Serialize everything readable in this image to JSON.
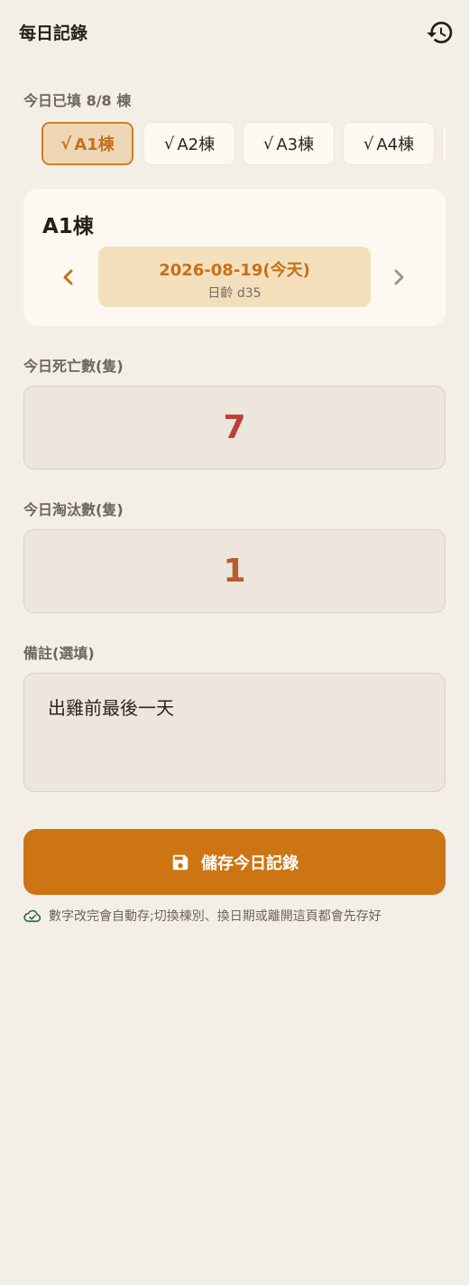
{
  "app_bar": {
    "title": "每日記錄",
    "history_icon": "history-icon"
  },
  "progress": {
    "label": "今日已填 8/8 棟",
    "filled": 8,
    "total": 8
  },
  "building_chips": [
    {
      "label": "A1棟",
      "check": "√",
      "selected": true
    },
    {
      "label": "A2棟",
      "check": "√",
      "selected": false
    },
    {
      "label": "A3棟",
      "check": "√",
      "selected": false
    },
    {
      "label": "A4棟",
      "check": "√",
      "selected": false
    }
  ],
  "building_card": {
    "title": "A1棟",
    "date": "2026-08-19(今天)",
    "age": "日齡 d35",
    "prev_icon": "chevron-left-icon",
    "next_icon": "chevron-right-icon"
  },
  "deaths": {
    "label": "今日死亡數(隻)",
    "value": "7",
    "color": "#b8413a"
  },
  "culls": {
    "label": "今日淘汰數(隻)",
    "value": "1",
    "color": "#b75d2a"
  },
  "notes": {
    "label": "備註(選填)",
    "value": "出雞前最後一天"
  },
  "save_button": {
    "label": "儲存今日記錄",
    "icon": "save-icon",
    "color": "#cc7512"
  },
  "hint": {
    "text": "數字改完會自動存;切換棟別、換日期或離開這頁都會先存好",
    "icon": "cloud-check-icon"
  },
  "colors": {
    "background": "#f3efe8",
    "accent": "#cc7512",
    "card": "#fdf9f2"
  }
}
